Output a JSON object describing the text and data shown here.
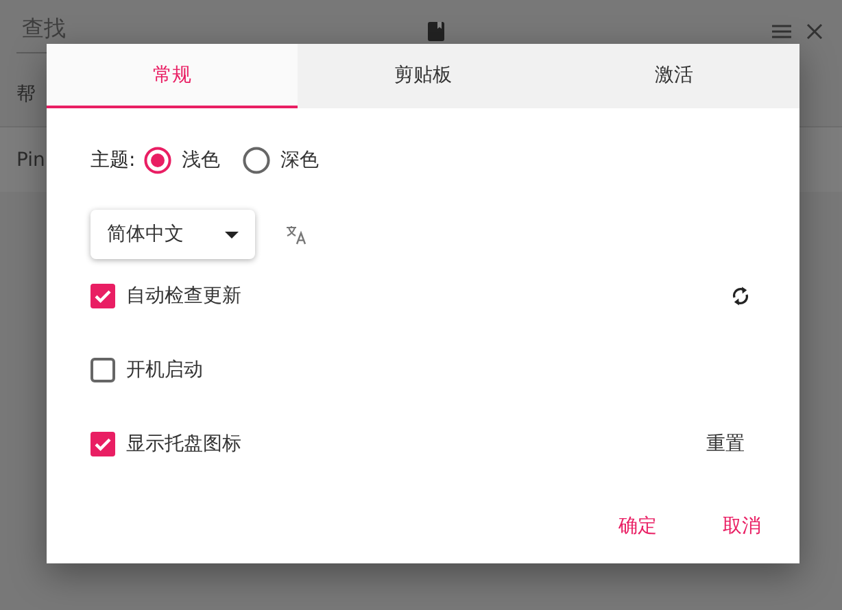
{
  "app": {
    "search": {
      "placeholder": "查找"
    },
    "list": [
      {
        "label": "帮"
      },
      {
        "label": "Pin"
      }
    ]
  },
  "dialog": {
    "tabs": [
      {
        "label": "常规",
        "selected": true
      },
      {
        "label": "剪贴板",
        "selected": false
      },
      {
        "label": "激活",
        "selected": false
      }
    ],
    "theme": {
      "label": "主题:",
      "options": [
        {
          "label": "浅色",
          "selected": true
        },
        {
          "label": "深色",
          "selected": false
        }
      ]
    },
    "language": {
      "value": "简体中文"
    },
    "options": [
      {
        "label": "自动检查更新",
        "checked": true,
        "kind": "icon-action"
      },
      {
        "label": "开机启动",
        "checked": false,
        "kind": "plain"
      },
      {
        "label": "显示托盘图标",
        "checked": true,
        "kind": "text-action",
        "action": "重置"
      }
    ],
    "buttons": [
      "确定",
      "取消"
    ]
  }
}
